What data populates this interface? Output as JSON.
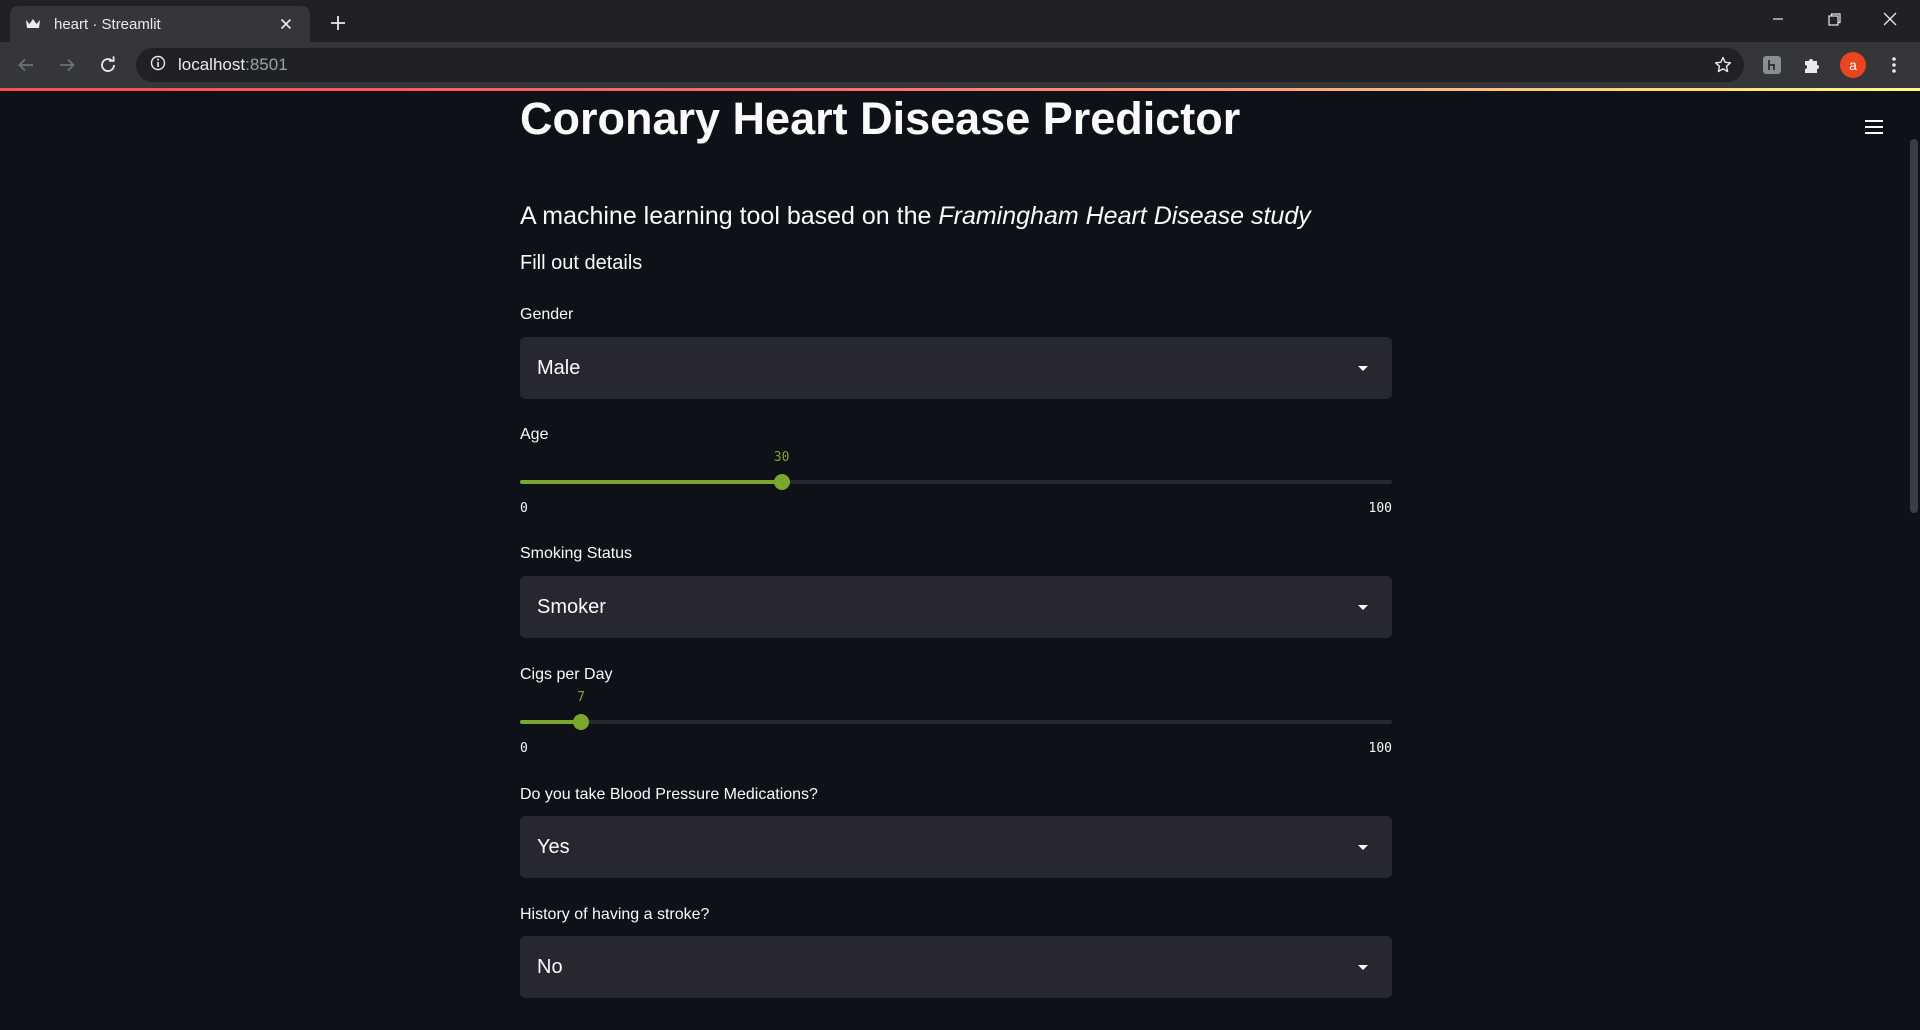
{
  "browser": {
    "tab_title": "heart · Streamlit",
    "url_host": "localhost",
    "url_port": ":8501",
    "avatar_letter": "a"
  },
  "app": {
    "title": "Coronary Heart Disease Predictor",
    "subtitle_prefix": "A machine learning tool based on the ",
    "subtitle_emphasis": "Framingham Heart Disease study",
    "instruction": "Fill out details",
    "accent_color": "#7ba72f",
    "fields": {
      "gender": {
        "label": "Gender",
        "value": "Male"
      },
      "age": {
        "label": "Age",
        "value": 30,
        "min": 0,
        "max": 100
      },
      "smoking": {
        "label": "Smoking Status",
        "value": "Smoker"
      },
      "cigs": {
        "label": "Cigs per Day",
        "value": 7,
        "min": 0,
        "max": 100
      },
      "bp_meds": {
        "label": "Do you take Blood Pressure Medications?",
        "value": "Yes"
      },
      "stroke": {
        "label": "History of having a stroke?",
        "value": "No"
      }
    }
  }
}
